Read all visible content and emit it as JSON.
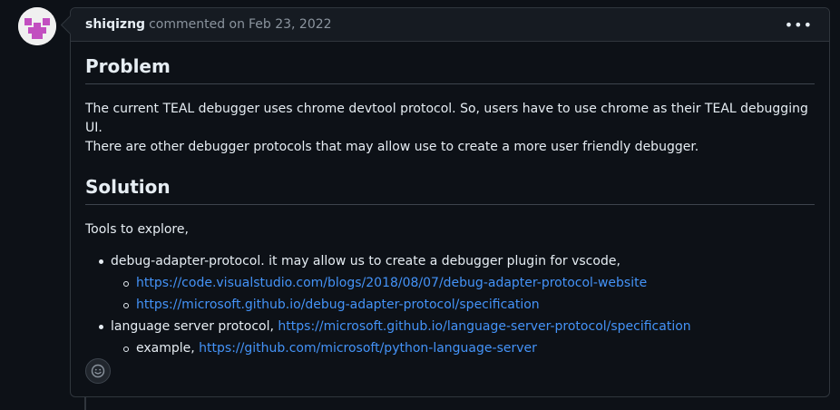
{
  "comment": {
    "author": "shiqizng",
    "action": "commented on",
    "date": "Feb 23, 2022",
    "menu_glyph": "•••"
  },
  "problem": {
    "heading": "Problem",
    "text_line1": "The current TEAL debugger uses chrome devtool protocol. So, users have to use chrome as their TEAL debugging UI.",
    "text_line2": "There are other debugger protocols that may allow use to create a more user friendly debugger."
  },
  "solution": {
    "heading": "Solution",
    "intro": "Tools to explore,",
    "items": [
      {
        "text": "debug-adapter-protocol. it may allow us to create a debugger plugin for vscode,",
        "subitems": [
          {
            "link": "https://code.visualstudio.com/blogs/2018/08/07/debug-adapter-protocol-website"
          },
          {
            "link": "https://microsoft.github.io/debug-adapter-protocol/specification"
          }
        ]
      },
      {
        "text": "language server protocol, ",
        "link": "https://microsoft.github.io/language-server-protocol/specification",
        "subitems": [
          {
            "text": "example, ",
            "link": "https://github.com/microsoft/python-language-server"
          }
        ]
      }
    ]
  },
  "icons": {
    "avatar": "identicon-avatar",
    "menu": "kebab-horizontal-icon",
    "reaction": "smiley-icon"
  },
  "colors": {
    "background": "#0d1117",
    "header_bg": "#161b22",
    "border": "#30363d",
    "text": "#e6edf3",
    "muted": "#8b949e",
    "link": "#4493f8",
    "avatar_accent": "#c24fc0"
  }
}
